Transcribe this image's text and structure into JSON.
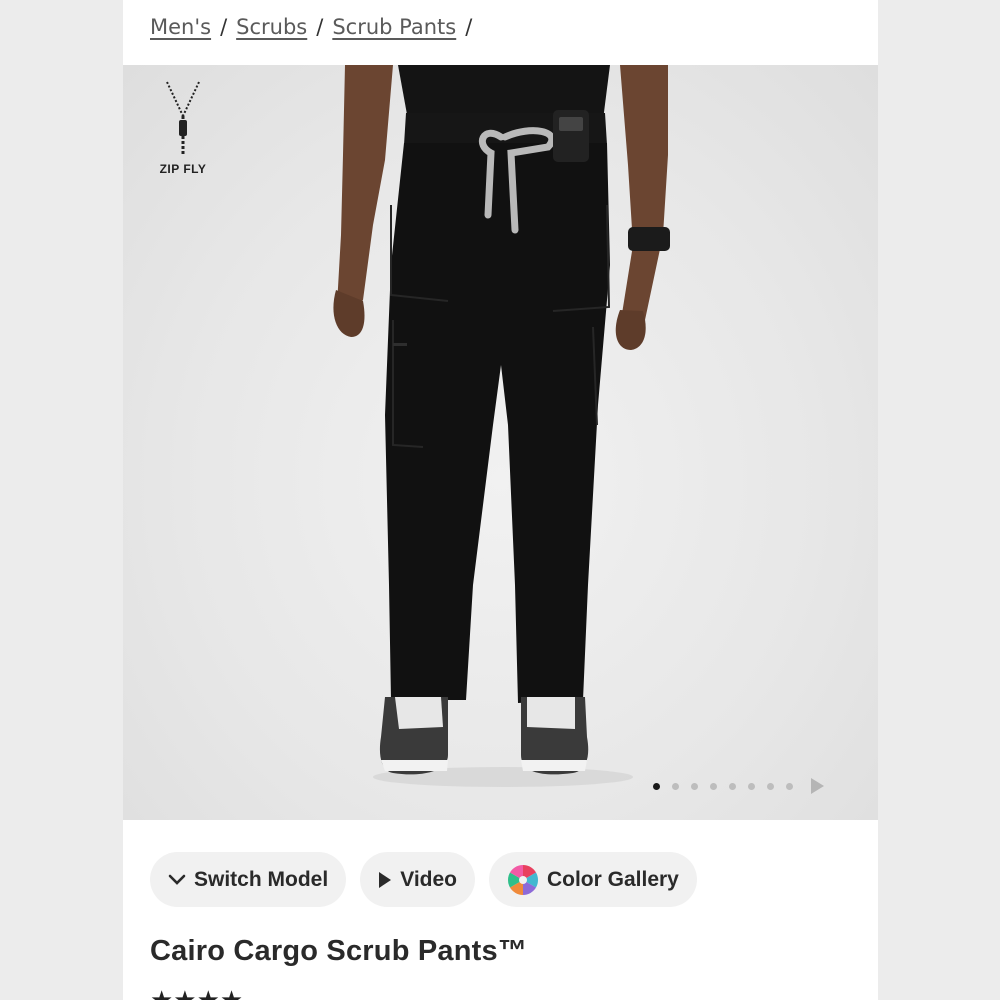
{
  "breadcrumb": {
    "items": [
      "Men's",
      "Scrubs",
      "Scrub Pants"
    ],
    "separator": "/"
  },
  "hero": {
    "badge_label": "ZIP FLY",
    "badge_icon": "zipper-icon",
    "carousel": {
      "dot_count": 8,
      "active_index": 0,
      "next_icon": "play-right-icon"
    }
  },
  "actions": {
    "switch_model": {
      "label": "Switch Model",
      "icon": "chevron-down-icon"
    },
    "video": {
      "label": "Video",
      "icon": "play-icon"
    },
    "color_gallery": {
      "label": "Color Gallery",
      "icon": "color-wheel-icon"
    }
  },
  "product": {
    "title": "Cairo Cargo Scrub Pants™",
    "rating_stars": "★★★★"
  },
  "colors": {
    "page_bg": "#ececec",
    "content_bg": "#ffffff",
    "pill_bg": "#f1f1f1",
    "text": "#2a2a2a",
    "pants": "#111111",
    "drawstring": "#b9b9b9"
  }
}
